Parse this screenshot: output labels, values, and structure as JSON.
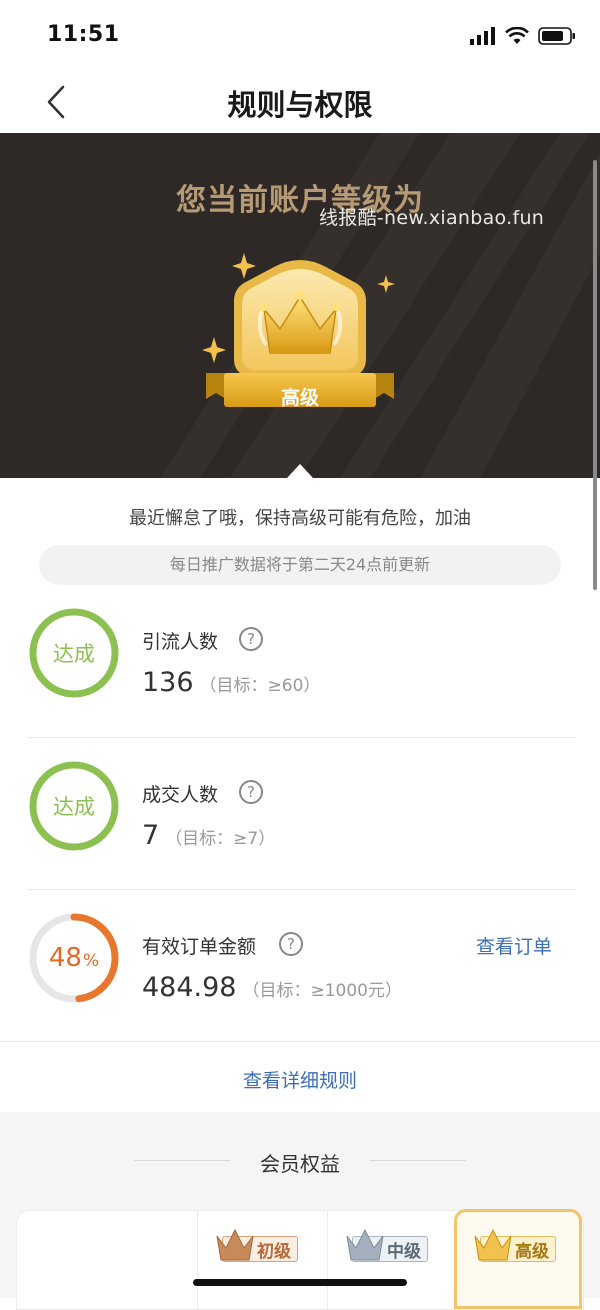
{
  "status_bar": {
    "time": "11:51"
  },
  "nav": {
    "title": "规则与权限"
  },
  "hero": {
    "title": "您当前账户等级为",
    "watermark": "线报酷-new.xianbao.fun",
    "level_badge": "高级",
    "colors": {
      "background": "#2e2926",
      "title": "#b59a74",
      "gold": "#f2c14e"
    }
  },
  "notice": {
    "warning": "最近懈怠了哦，保持高级可能有危险，加油",
    "update_info": "每日推广数据将于第二天24点前更新"
  },
  "metrics": [
    {
      "name": "引流人数",
      "status": "达成",
      "value": "136",
      "target": "（目标：≥60）",
      "progress": 1.0
    },
    {
      "name": "成交人数",
      "status": "达成",
      "value": "7",
      "target": "（目标：≥7）",
      "progress": 1.0
    },
    {
      "name": "有效订单金额",
      "status": "48",
      "status_unit": "%",
      "value": "484.98",
      "target": "（目标：≥1000元）",
      "progress": 0.48,
      "action": "查看订单"
    }
  ],
  "detail_link": "查看详细规则",
  "benefits": {
    "title": "会员权益",
    "tiers": [
      {
        "label": "初级",
        "color": "#c98a5a"
      },
      {
        "label": "中级",
        "color": "#8a98a8"
      },
      {
        "label": "高级",
        "color": "#d9a62c"
      }
    ]
  },
  "icons": [
    "chevron-left-icon",
    "signal-icon",
    "wifi-icon",
    "battery-icon",
    "crown-icon",
    "sparkle-icon",
    "question-icon"
  ]
}
